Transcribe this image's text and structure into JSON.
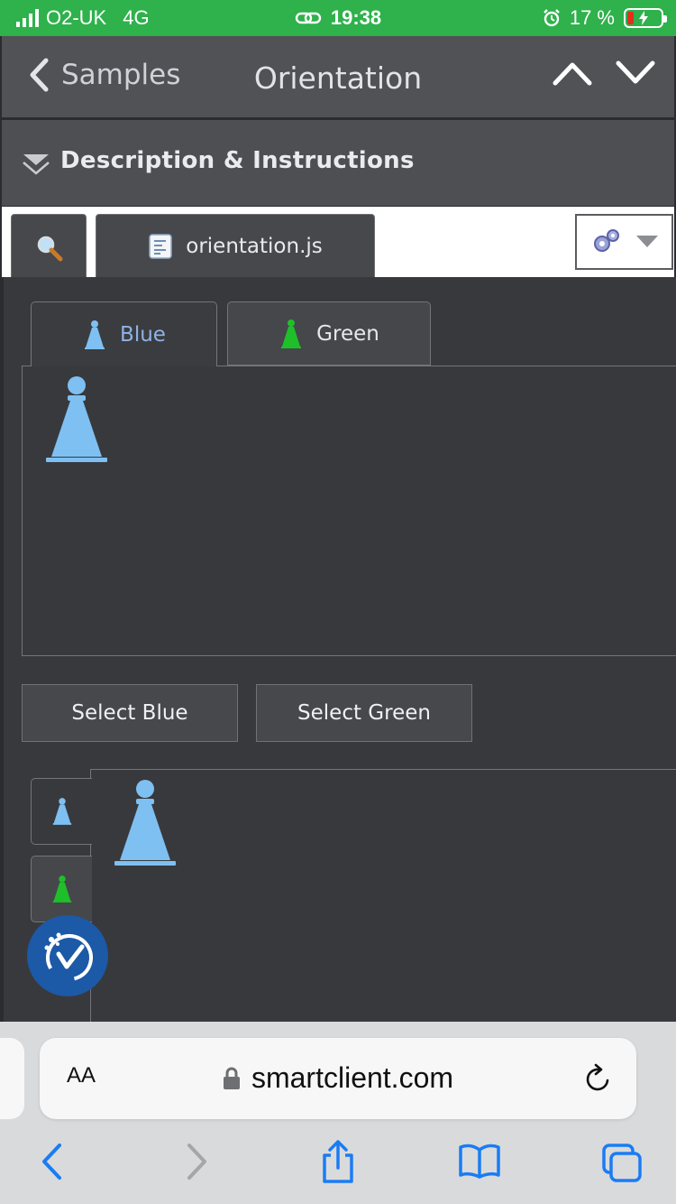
{
  "status": {
    "carrier": "O2-UK",
    "network": "4G",
    "time": "19:38",
    "battery": "17 %"
  },
  "nav": {
    "back_label": "Samples",
    "title": "Orientation"
  },
  "description": {
    "label": "Description & Instructions"
  },
  "source_tabs": {
    "file_label": "orientation.js"
  },
  "tabs_top": [
    {
      "label": "Blue"
    },
    {
      "label": "Green"
    }
  ],
  "buttons": {
    "select_blue": "Select Blue",
    "select_green": "Select Green"
  },
  "browser": {
    "text_size_label": "AA",
    "url": "smartclient.com"
  },
  "colors": {
    "status_green": "#2fb14c",
    "pawn_blue": "#7ec0f2",
    "pawn_green": "#1fbf2a",
    "tab_selected_text": "#8fb2e6",
    "badge_blue": "#1c59a6",
    "ios_blue": "#1a7cf3"
  },
  "icons": [
    "back-chevron-icon",
    "up-chevron-icon",
    "down-chevron-icon",
    "collapse-triangle-icon",
    "magnifier-icon",
    "js-file-icon",
    "gear-icon",
    "blue-pawn-icon",
    "green-pawn-icon",
    "accessibility-badge-icon",
    "lock-icon",
    "reload-icon",
    "back-icon",
    "forward-icon",
    "share-icon",
    "bookmarks-icon",
    "tabs-icon"
  ]
}
